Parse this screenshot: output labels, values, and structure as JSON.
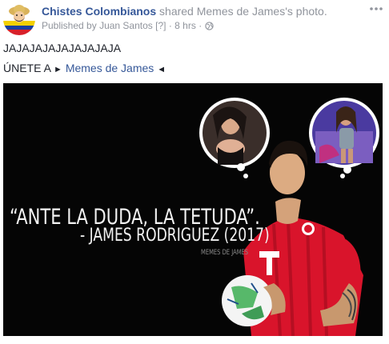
{
  "header": {
    "page_name": "Chistes Colombianos",
    "shared_text": "shared",
    "shared_source": "Memes de James",
    "shared_suffix": "'s photo.",
    "published_prefix": "Published by",
    "author": "Juan Santos",
    "author_marker": "[?]",
    "time": "8 hrs",
    "separator": "·"
  },
  "post": {
    "text_line1": "JAJAJAJAJAJAJAJAJA",
    "text_line2_prefix": "ÚNETE A",
    "arrow_right": "►",
    "link_text": "Memes de James",
    "arrow_left": "◄"
  },
  "photo": {
    "quote": "“ANTE LA DUDA, LA TETUDA”.",
    "attribution": "- JAMES RODRIGUEZ (2017)",
    "watermark": "MEMES DE JAMES"
  },
  "colors": {
    "link_blue": "#365899",
    "meta_gray": "#90949c",
    "text": "#1d2129",
    "jersey_red": "#d9142b"
  }
}
